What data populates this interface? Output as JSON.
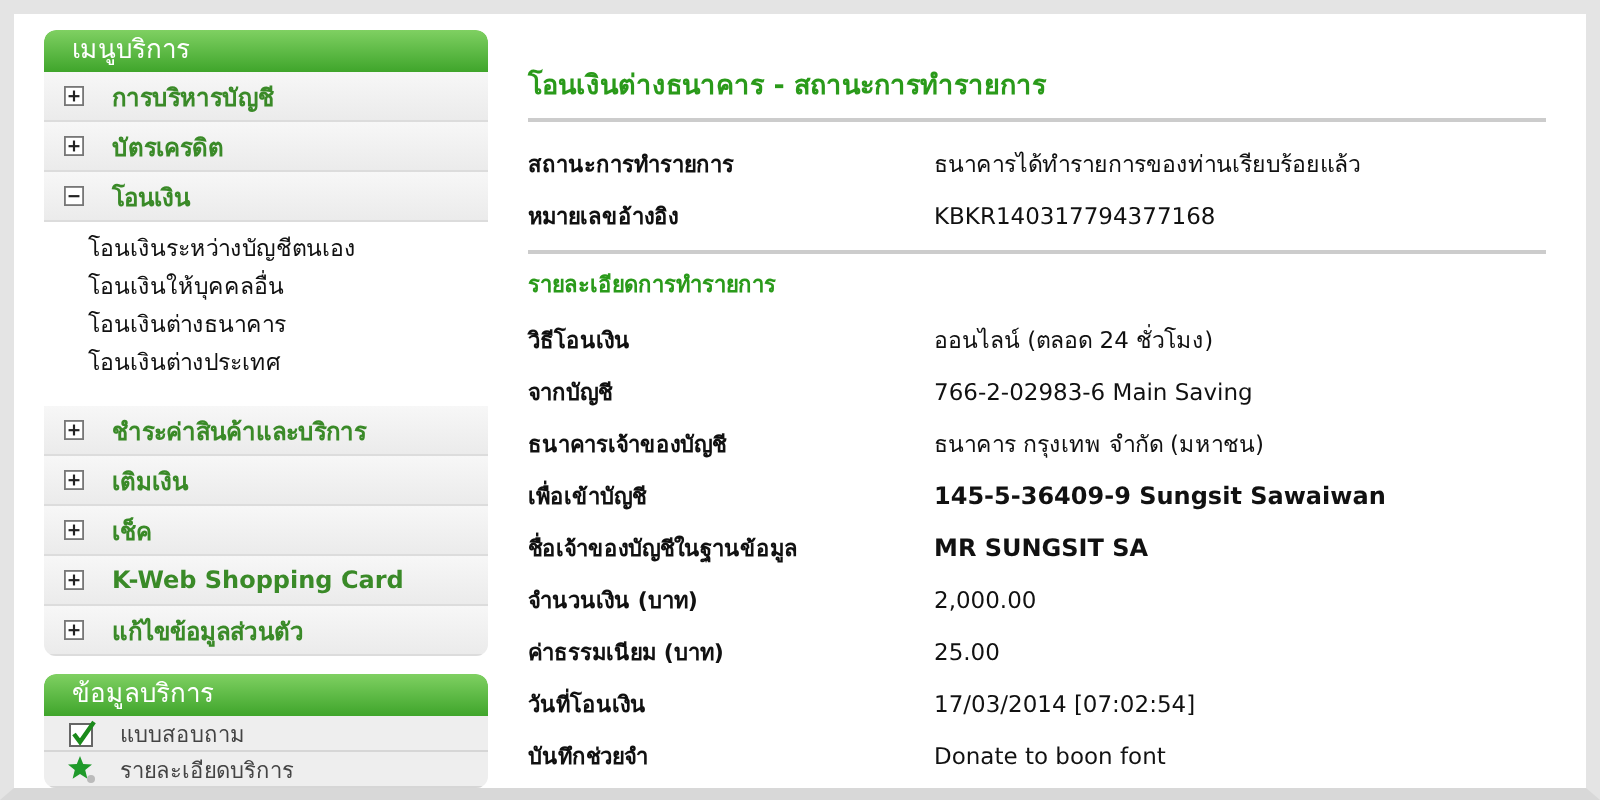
{
  "sidebar": {
    "menu_title": "เมนูบริการ",
    "items": [
      {
        "label": "การบริหารบัญชี",
        "expanded": false
      },
      {
        "label": "บัตรเครดิต",
        "expanded": false
      },
      {
        "label": "โอนเงิน",
        "expanded": true,
        "children": [
          {
            "label": "โอนเงินระหว่างบัญชีตนเอง"
          },
          {
            "label": "โอนเงินให้บุคคลอื่น"
          },
          {
            "label": "โอนเงินต่างธนาคาร"
          },
          {
            "label": "โอนเงินต่างประเทศ"
          }
        ]
      },
      {
        "label": "ชำระค่าสินค้าและบริการ",
        "expanded": false
      },
      {
        "label": "เติมเงิน",
        "expanded": false
      },
      {
        "label": "เช็ค",
        "expanded": false
      },
      {
        "label": "K-Web Shopping Card",
        "expanded": false
      },
      {
        "label": "แก้ไขข้อมูลส่วนตัว",
        "expanded": false
      }
    ],
    "info_title": "ข้อมูลบริการ",
    "info_items": [
      {
        "kind": "check",
        "label": "แบบสอบถาม"
      },
      {
        "kind": "star",
        "label": "รายละเอียดบริการ"
      }
    ]
  },
  "main": {
    "title": "โอนเงินต่างธนาคาร - สถานะการทำรายการ",
    "status_rows": [
      {
        "label": "สถานะการทำรายการ",
        "value": "ธนาคารได้ทำรายการของท่านเรียบร้อยแล้ว",
        "bold": false
      },
      {
        "label": "หมายเลขอ้างอิง",
        "value": "KBKR140317794377168",
        "bold": false
      }
    ],
    "details_title": "รายละเอียดการทำรายการ",
    "detail_rows": [
      {
        "label": "วิธีโอนเงิน",
        "value": "ออนไลน์ (ตลอด 24 ชั่วโมง)",
        "bold": false
      },
      {
        "label": "จากบัญชี",
        "value": "766-2-02983-6 Main Saving",
        "bold": false
      },
      {
        "label": "ธนาคารเจ้าของบัญชี",
        "value": "ธนาคาร กรุงเทพ จำกัด (มหาชน)",
        "bold": false
      },
      {
        "label": "เพื่อเข้าบัญชี",
        "value": "145-5-36409-9 Sungsit Sawaiwan",
        "bold": true
      },
      {
        "label": "ชื่อเจ้าของบัญชีในฐานข้อมูล",
        "value": "MR SUNGSIT SA",
        "bold": true
      },
      {
        "label": "จำนวนเงิน (บาท)",
        "value": "2,000.00",
        "bold": false
      },
      {
        "label": "ค่าธรรมเนียม (บาท)",
        "value": "25.00",
        "bold": false
      },
      {
        "label": "วันที่โอนเงิน",
        "value": "17/03/2014 [07:02:54]",
        "bold": false
      },
      {
        "label": "บันทึกช่วยจำ",
        "value": "Donate to boon font",
        "bold": false
      }
    ]
  }
}
